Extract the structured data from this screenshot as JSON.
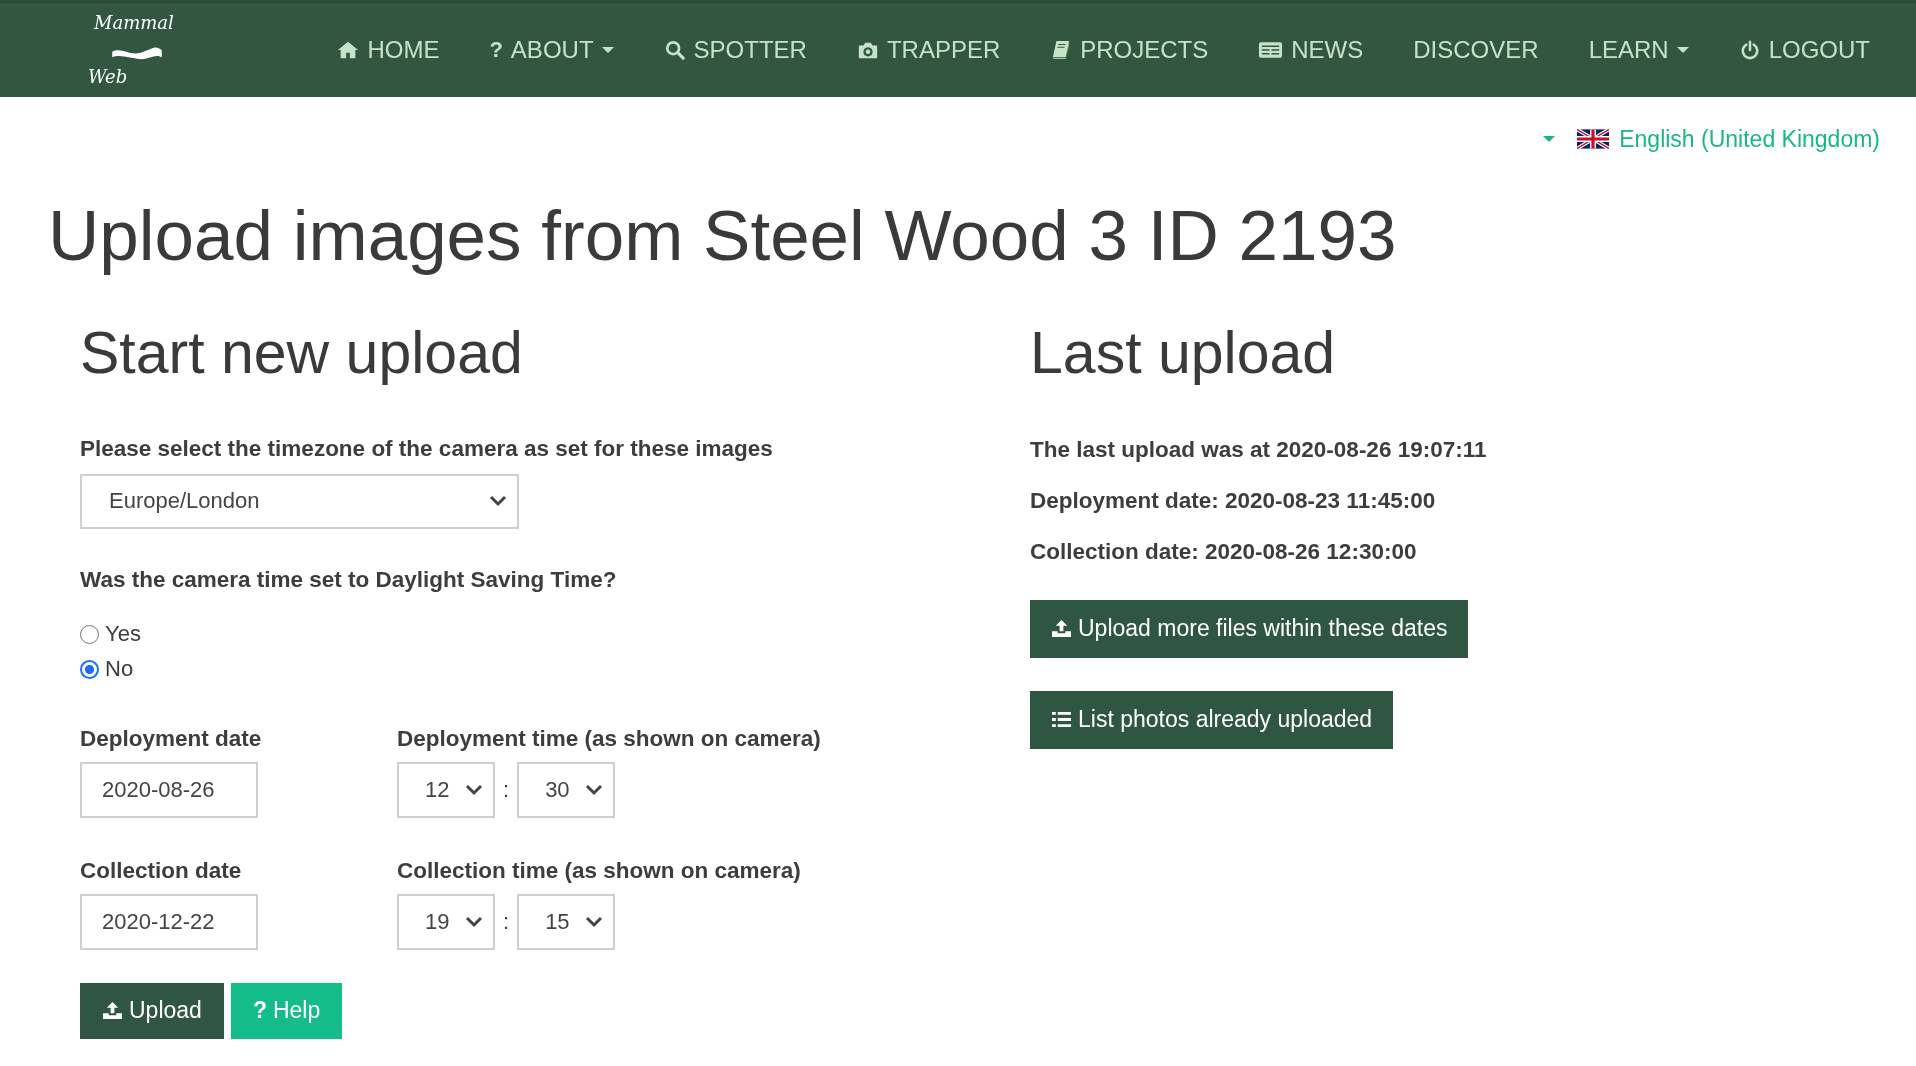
{
  "header": {
    "logo": {
      "line_1": "Mammal",
      "line_2": "Web"
    },
    "nav": [
      {
        "label": "HOME",
        "kind": "home",
        "dropdown": false
      },
      {
        "label": "ABOUT",
        "kind": "text",
        "icon_text": "?",
        "dropdown": true
      },
      {
        "label": "SPOTTER",
        "kind": "search",
        "dropdown": false
      },
      {
        "label": "TRAPPER",
        "kind": "camera",
        "dropdown": false
      },
      {
        "label": "PROJECTS",
        "kind": "book",
        "dropdown": false
      },
      {
        "label": "NEWS",
        "kind": "newspaper",
        "dropdown": false
      },
      {
        "label": "DISCOVER",
        "kind": "text",
        "dropdown": false
      },
      {
        "label": "LEARN",
        "kind": "text",
        "dropdown": true
      },
      {
        "label": "LOGOUT",
        "kind": "power",
        "dropdown": false
      }
    ]
  },
  "language": {
    "label": "English (United Kingdom)"
  },
  "title": "Upload images from Steel Wood 3 ID 2193",
  "new_upload": {
    "heading": "Start new upload",
    "timezone": {
      "label": "Please select the timezone of the camera as set for these images",
      "value": "Europe/London"
    },
    "dst": {
      "question": "Was the camera time set to Daylight Saving Time?",
      "options": [
        {
          "label": "Yes",
          "selected": false
        },
        {
          "label": "No",
          "selected": true
        }
      ]
    },
    "periods": [
      {
        "date_label": "Deployment date",
        "date": "2020-08-26",
        "time_label": "Deployment time (as shown on camera)",
        "hour": "12",
        "separator": ":",
        "minute": "30"
      },
      {
        "date_label": "Collection date",
        "date": "2020-12-22",
        "time_label": "Collection time (as shown on camera)",
        "hour": "19",
        "separator": ":",
        "minute": "15"
      }
    ],
    "buttons": [
      {
        "label": "Upload",
        "kind": "upload"
      },
      {
        "label": "Help",
        "kind": "help",
        "icon_text": "?"
      }
    ]
  },
  "last_upload": {
    "heading": "Last upload",
    "lines": [
      "The last upload was at 2020-08-26 19:07:11",
      "Deployment date: 2020-08-23 11:45:00",
      "Collection date: 2020-08-26 12:30:00"
    ],
    "buttons": [
      {
        "label": "Upload more files within these dates",
        "kind": "upload"
      },
      {
        "label": "List photos already uploaded",
        "kind": "list"
      }
    ]
  }
}
